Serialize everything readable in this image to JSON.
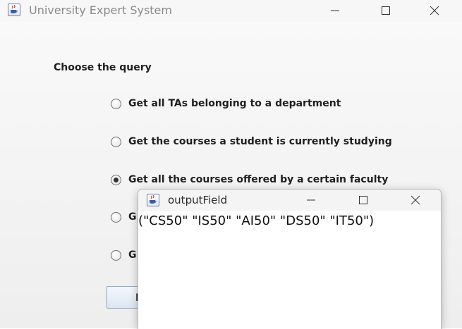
{
  "window": {
    "title": "University Expert System",
    "icon": "java-cup-icon",
    "controls": [
      "minimize-icon",
      "maximize-icon",
      "close-icon"
    ]
  },
  "query": {
    "heading": "Choose the query",
    "options": [
      {
        "label": "Get all TAs belonging to a department",
        "selected": false
      },
      {
        "label": "Get the courses a student is currently studying",
        "selected": false
      },
      {
        "label": "Get all the courses offered by a certain faculty",
        "selected": true
      },
      {
        "label": "G",
        "selected": false
      },
      {
        "label": "G",
        "selected": false
      }
    ],
    "button_label": "R"
  },
  "output_window": {
    "title": "outputField",
    "icon": "java-cup-icon",
    "text": "(\"CS50\" \"IS50\" \"AI50\" \"DS50\" \"IT50\")"
  }
}
